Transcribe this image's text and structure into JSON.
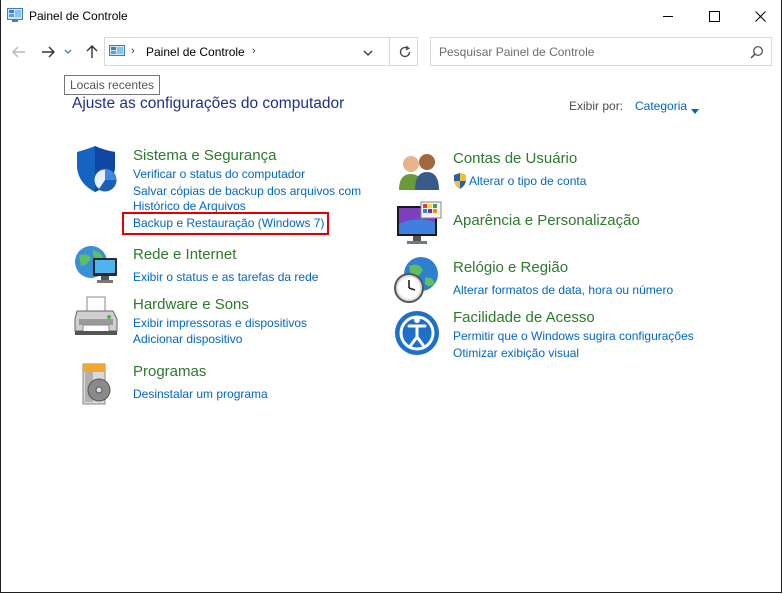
{
  "window": {
    "title": "Painel de Controle"
  },
  "nav": {
    "back_icon": "back-arrow-icon",
    "forward_icon": "forward-arrow-icon",
    "recent_icon": "chevron-down-icon",
    "up_icon": "up-arrow-icon"
  },
  "address": {
    "path_item": "Painel de Controle"
  },
  "search": {
    "placeholder": "Pesquisar Painel de Controle"
  },
  "tooltip": {
    "text": "Locais recentes"
  },
  "main": {
    "heading": "Ajuste as configurações do computador",
    "view_by_label": "Exibir por:",
    "view_by_value": "Categoria"
  },
  "categories_left": [
    {
      "title": "Sistema e Segurança",
      "icon": "shield-icon",
      "links": [
        "Verificar o status do computador",
        "Salvar cópias de backup dos arquivos com",
        "Histórico de Arquivos",
        "Backup e Restauração (Windows 7)"
      ]
    },
    {
      "title": "Rede e Internet",
      "icon": "network-globe-icon",
      "links": [
        "Exibir o status e as tarefas da rede"
      ]
    },
    {
      "title": "Hardware e Sons",
      "icon": "printer-icon",
      "links": [
        "Exibir impressoras e dispositivos",
        "Adicionar dispositivo"
      ]
    },
    {
      "title": "Programas",
      "icon": "programs-disc-icon",
      "links": [
        "Desinstalar um programa"
      ]
    }
  ],
  "categories_right": [
    {
      "title": "Contas de Usuário",
      "icon": "users-icon",
      "links": [
        "Alterar o tipo de conta"
      ]
    },
    {
      "title": "Aparência e Personalização",
      "icon": "monitor-palette-icon",
      "links": []
    },
    {
      "title": "Relógio e Região",
      "icon": "clock-globe-icon",
      "links": [
        "Alterar formatos de data, hora ou número"
      ]
    },
    {
      "title": "Facilidade de Acesso",
      "icon": "accessibility-icon",
      "links": [
        "Permitir que o Windows sugira configurações",
        "Otimizar exibição visual"
      ]
    }
  ],
  "colors": {
    "category_title": "#2c7a2c",
    "link": "#0066cc",
    "heading": "#1e3287",
    "highlight_box": "#e00000"
  }
}
